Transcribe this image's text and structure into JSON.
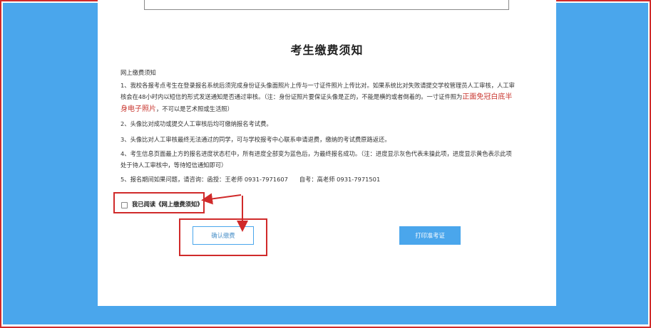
{
  "notice": {
    "title": "考生缴费须知",
    "subtitle": "网上缴费须知",
    "item1_a": "1、我校各报考点考生在登录报名系统后须完成身份证头像面照片上传与一寸证件照片上传比对。如果系统比对失败请提交学校管理员人工审核，人工审",
    "item1_b": "核会在48小时内以短信的形式发送通知是否通过审核。（注：身份证照片要保证头像是正的，不能是横的或者倒着的。一寸证件照为",
    "item1_red": "正面免冠白底半",
    "item1_c_red": "身电子照片",
    "item1_c": "，不可以是艺术照或生活照）",
    "item2": "2、头像比对成功或提交人工审核后均可缴纳报名考试费。",
    "item3": "3、头像比对人工审核最终无法通过的同学，可与学校报考中心联系申请退费，缴纳的考试费原路返还。",
    "item4_a": "4、考生信息页面最上方的报名进度状态栏中，所有进度全部变为蓝色后，为最终报名成功。（注：进度显示灰色代表未操此项，进度显示黄色表示此项",
    "item4_b": "处于待人工审核中，等待短信通知即可）",
    "item5": "5、报名期间如果问题，请咨询：函授：王老师 0931-7971607      自考：高老师 0931-7971501"
  },
  "agree_label": "我已阅读《网上缴费须知》",
  "buttons": {
    "confirm": "确认缴费",
    "print": "打印准考证"
  },
  "colors": {
    "accent_blue": "#4aa6ec",
    "highlight_red": "#d02a2a"
  }
}
